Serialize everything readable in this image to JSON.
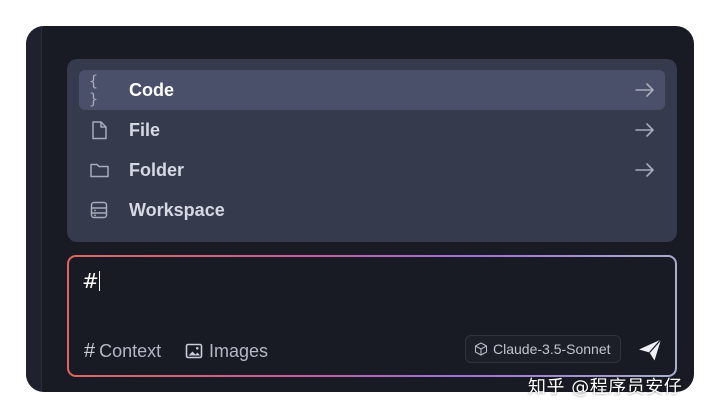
{
  "menu": {
    "items": [
      {
        "label": "Code",
        "icon": "code-braces-icon",
        "selected": true,
        "has_arrow": true
      },
      {
        "label": "File",
        "icon": "file-icon",
        "selected": false,
        "has_arrow": true
      },
      {
        "label": "Folder",
        "icon": "folder-icon",
        "selected": false,
        "has_arrow": true
      },
      {
        "label": "Workspace",
        "icon": "workspace-server-icon",
        "selected": false,
        "has_arrow": false
      }
    ],
    "code_icon_glyph": "{ }"
  },
  "input": {
    "value": "#"
  },
  "toolbar": {
    "context_glyph": "#",
    "context_label": "Context",
    "images_label": "Images",
    "model_label": "Claude-3.5-Sonnet",
    "send_icon": "send-paper-plane-icon"
  },
  "watermark": {
    "text": "知乎 @程序员安仔"
  },
  "colors": {
    "window_bg": "#181a24",
    "menu_bg": "#353a4d",
    "selected_bg": "#4a5069",
    "gradient": [
      "#e0665d",
      "#c45da0",
      "#9f6fd8",
      "#a8b0cc"
    ]
  }
}
